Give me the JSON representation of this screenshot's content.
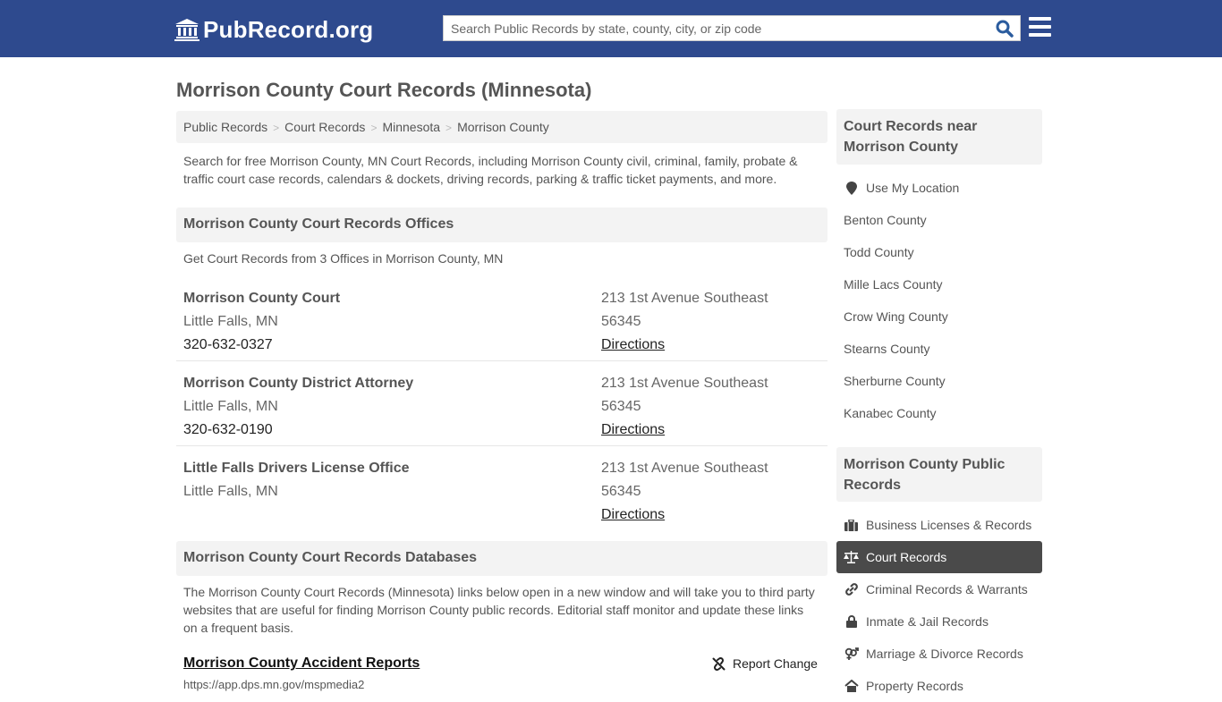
{
  "header": {
    "logo_text": "PubRecord.org",
    "logo_icon": "courthouse-icon",
    "search_placeholder": "Search Public Records by state, county, city, or zip code",
    "search_icon": "search-icon",
    "menu_icon": "hamburger-menu-icon",
    "bg_color": "#2e4a8e"
  },
  "page": {
    "title": "Morrison County Court Records (Minnesota)",
    "breadcrumb": [
      "Public Records",
      "Court Records",
      "Minnesota",
      "Morrison County"
    ],
    "breadcrumb_separator": ">",
    "intro": "Search for free Morrison County, MN Court Records, including Morrison County civil, criminal, family, probate & traffic court case records, calendars & dockets, driving records, parking & traffic ticket payments, and more."
  },
  "offices": {
    "heading": "Morrison County Court Records Offices",
    "subnote": "Get Court Records from 3 Offices in Morrison County, MN",
    "items": [
      {
        "name": "Morrison County Court",
        "city": "Little Falls, MN",
        "phone": "320-632-0327",
        "address": "213 1st Avenue Southeast",
        "zip": "56345",
        "directions": "Directions"
      },
      {
        "name": "Morrison County District Attorney",
        "city": "Little Falls, MN",
        "phone": "320-632-0190",
        "address": "213 1st Avenue Southeast",
        "zip": "56345",
        "directions": "Directions"
      },
      {
        "name": "Little Falls Drivers License Office",
        "city": "Little Falls, MN",
        "phone": "",
        "address": "213 1st Avenue Southeast",
        "zip": "56345",
        "directions": "Directions"
      }
    ]
  },
  "databases": {
    "heading": "Morrison County Court Records Databases",
    "intro": "The Morrison County Court Records (Minnesota) links below open in a new window and will take you to third party websites that are useful for finding Morrison County public records. Editorial staff monitor and update these links on a frequent basis.",
    "items": [
      {
        "title": "Morrison County Accident Reports",
        "url": "https://app.dps.mn.gov/mspmedia2",
        "report_label": "Report Change",
        "report_icon": "broken-link-icon"
      }
    ]
  },
  "sidebar": {
    "nearby": {
      "heading": "Court Records near Morrison County",
      "use_location": {
        "label": "Use My Location",
        "icon": "map-marker-icon"
      },
      "counties": [
        "Benton County",
        "Todd County",
        "Mille Lacs County",
        "Crow Wing County",
        "Stearns County",
        "Sherburne County",
        "Kanabec County"
      ]
    },
    "public_records": {
      "heading": "Morrison County Public Records",
      "items": [
        {
          "label": "Business Licenses & Records",
          "icon": "briefcase-icon",
          "active": false
        },
        {
          "label": "Court Records",
          "icon": "scales-icon",
          "active": true
        },
        {
          "label": "Criminal Records & Warrants",
          "icon": "link-icon",
          "active": false
        },
        {
          "label": "Inmate & Jail Records",
          "icon": "lock-icon",
          "active": false
        },
        {
          "label": "Marriage & Divorce Records",
          "icon": "gender-icon",
          "active": false
        },
        {
          "label": "Property Records",
          "icon": "home-icon",
          "active": false
        }
      ]
    }
  }
}
